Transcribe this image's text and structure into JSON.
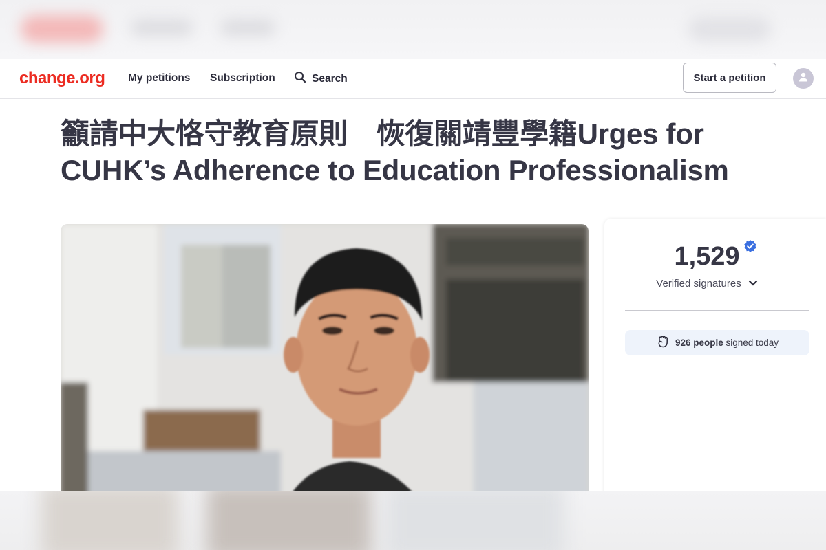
{
  "nav": {
    "logo": "change.org",
    "links": [
      "My petitions",
      "Subscription"
    ],
    "search_label": "Search",
    "start_button": "Start a petition"
  },
  "petition": {
    "title": "籲請中大恪守教育原則　恢復關靖豐學籍Urges for CUHK’s Adherence to Education Professionalism"
  },
  "signatures": {
    "count": "1,529",
    "label": "Verified signatures",
    "today_count": "926 people",
    "today_text": "signed today"
  },
  "icons": [
    "search-icon",
    "user-icon",
    "verified-badge-icon",
    "chevron-down-icon",
    "raised-fist-icon"
  ],
  "colors": {
    "brand": "#ec2c22",
    "verified": "#3a6fe0",
    "today_bg": "#eef3fb"
  }
}
